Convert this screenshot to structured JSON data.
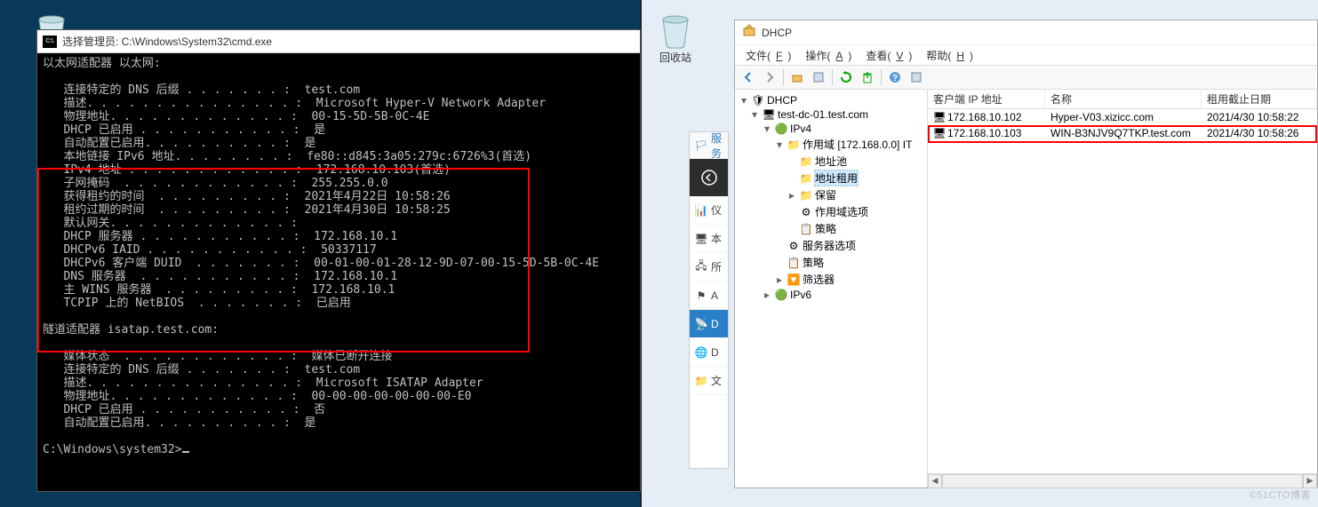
{
  "desktop": {
    "recycle_label": "回收站"
  },
  "cmd": {
    "title": "选择管理员: C:\\Windows\\System32\\cmd.exe",
    "icon_text": "C:\\.",
    "header_line": "以太网适配器 以太网:",
    "lines": [
      "连接特定的 DNS 后缀 . . . . . . . :  test.com",
      "描述. . . . . . . . . . . . . . . :  Microsoft Hyper-V Network Adapter",
      "物理地址. . . . . . . . . . . . . :  00-15-5D-5B-0C-4E",
      "DHCP 已启用 . . . . . . . . . . . :  是",
      "自动配置已启用. . . . . . . . . . :  是",
      "本地链接 IPv6 地址. . . . . . . . :  fe80::d845:3a05:279c:6726%3(首选)",
      "IPv4 地址 . . . . . . . . . . . . :  172.168.10.103(首选)",
      "子网掩码  . . . . . . . . . . . . :  255.255.0.0",
      "获得租约的时间  . . . . . . . . . :  2021年4月22日 10:58:26",
      "租约过期的时间  . . . . . . . . . :  2021年4月30日 10:58:25",
      "默认网关. . . . . . . . . . . . . :",
      "DHCP 服务器 . . . . . . . . . . . :  172.168.10.1",
      "DHCPv6 IAID . . . . . . . . . . . :  50337117",
      "DHCPv6 客户端 DUID  . . . . . . . :  00-01-00-01-28-12-9D-07-00-15-5D-5B-0C-4E",
      "DNS 服务器  . . . . . . . . . . . :  172.168.10.1",
      "主 WINS 服务器  . . . . . . . . . :  172.168.10.1",
      "TCPIP 上的 NetBIOS  . . . . . . . :  已启用"
    ],
    "tunnel_header": "隧道适配器 isatap.test.com:",
    "tunnel_lines": [
      "媒体状态  . . . . . . . . . . . . :  媒体已断开连接",
      "连接特定的 DNS 后缀 . . . . . . . :  test.com",
      "描述. . . . . . . . . . . . . . . :  Microsoft ISATAP Adapter",
      "物理地址. . . . . . . . . . . . . :  00-00-00-00-00-00-00-E0",
      "DHCP 已启用 . . . . . . . . . . . :  否",
      "自动配置已启用. . . . . . . . . . :  是"
    ],
    "prompt": "C:\\Windows\\system32>"
  },
  "dhcp": {
    "title": "DHCP",
    "menu": {
      "file": "文件(F)",
      "action": "操作(A)",
      "view": "查看(V)",
      "help": "帮助(H)"
    },
    "tree": {
      "root": "DHCP",
      "server": "test-dc-01.test.com",
      "ipv4": "IPv4",
      "scope": "作用域 [172.168.0.0] IT",
      "pool": "地址池",
      "leases": "地址租用",
      "reservations": "保留",
      "scope_options": "作用域选项",
      "policies": "策略",
      "server_options": "服务器选项",
      "policies2": "策略",
      "filters": "筛选器",
      "ipv6": "IPv6"
    },
    "columns": {
      "ip": "客户端 IP 地址",
      "name": "名称",
      "expiry": "租用截止日期"
    },
    "rows": [
      {
        "ip": "172.168.10.102",
        "name": "Hyper-V03.xizicc.com",
        "expiry": "2021/4/30 10:58:22"
      },
      {
        "ip": "172.168.10.103",
        "name": "WIN-B3NJV9Q7TKP.test.com",
        "expiry": "2021/4/30 10:58:26"
      }
    ]
  },
  "side": {
    "top": "服务",
    "items": [
      "仪",
      "本",
      "所",
      "A",
      "D",
      "D",
      "文"
    ]
  },
  "watermark": "©51CTO博客"
}
